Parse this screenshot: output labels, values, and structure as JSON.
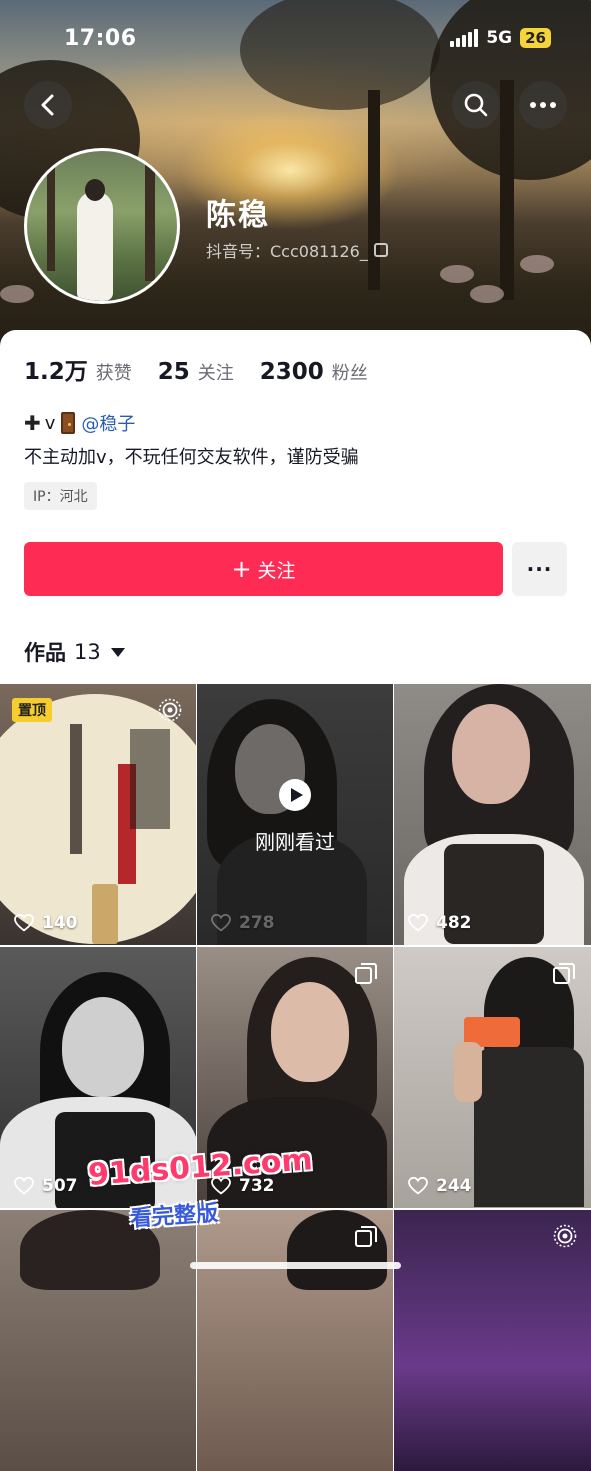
{
  "status_bar": {
    "time": "17:06",
    "network": "5G",
    "battery": "26"
  },
  "profile": {
    "nickname": "陈稳",
    "douyin_id": "抖音号：Ccc081126_",
    "stats": [
      {
        "value": "1.2万",
        "label": "获赞"
      },
      {
        "value": "25",
        "label": "关注"
      },
      {
        "value": "2300",
        "label": "粉丝"
      }
    ],
    "bio_line1_prefix": "v",
    "bio_mention": "@稳子",
    "bio_line2": "不主动加v，不玩任何交友软件，谨防受骗",
    "ip": "IP：河北"
  },
  "actions": {
    "follow_label": "关注",
    "more_label": "···"
  },
  "works_tab": {
    "label": "作品",
    "count": "13"
  },
  "posts": [
    {
      "likes": "140",
      "pinned": true,
      "pin_label": "置顶",
      "icon": "live-photo-icon"
    },
    {
      "likes": "278",
      "watched": true,
      "watched_label": "刚刚看过"
    },
    {
      "likes": "482"
    },
    {
      "likes": "507"
    },
    {
      "likes": "732",
      "icon": "multi-image-icon"
    },
    {
      "likes": "244",
      "icon": "multi-image-icon"
    }
  ],
  "watermark": {
    "text": "91ds012.com",
    "sub": "看完整版"
  },
  "colors": {
    "follow_button": "#fe2c55",
    "pin_badge": "#f5cd2c",
    "mention": "#2a5db0"
  }
}
